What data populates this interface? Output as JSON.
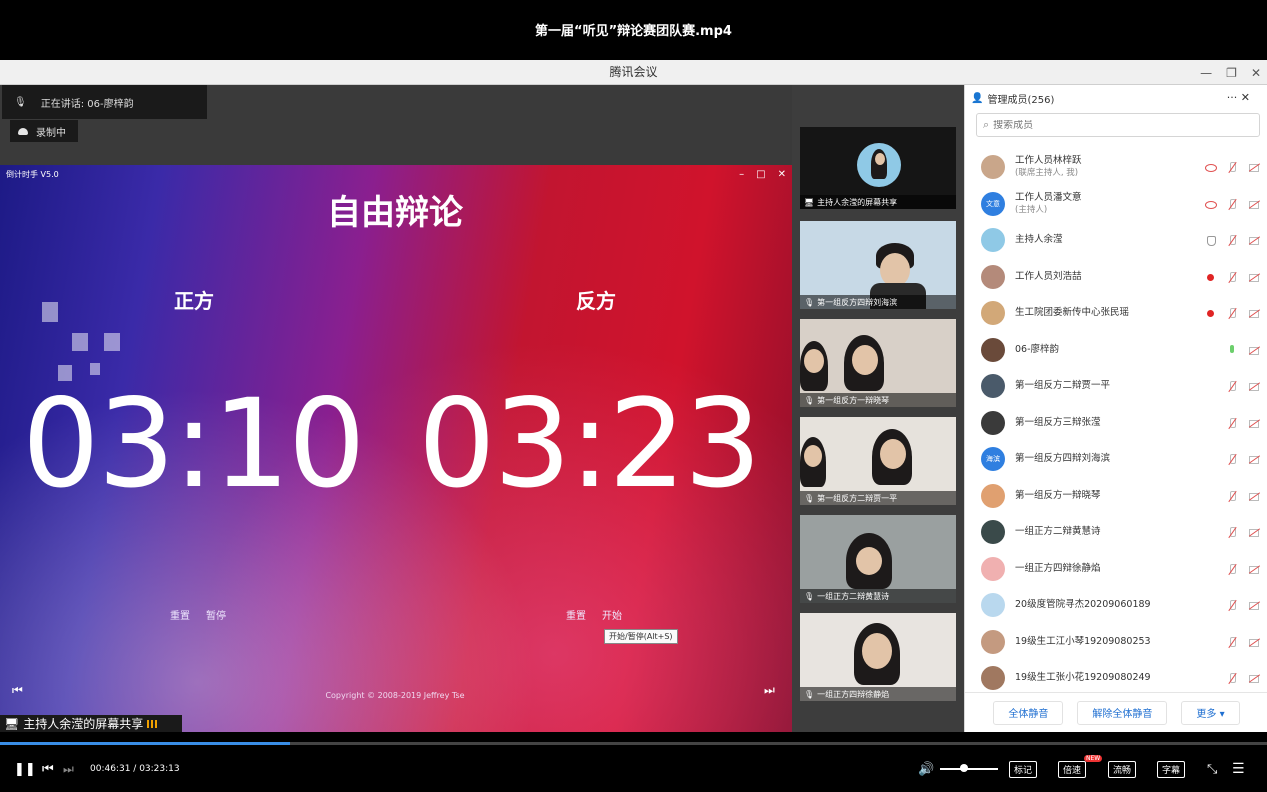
{
  "player": {
    "title": "第一届“听见”辩论赛团队赛.mp4",
    "current_time": "00:46:31",
    "separator": " / ",
    "total_time": "03:23:13",
    "progress": 0.229,
    "volume": 0.42,
    "buttons": {
      "mark": "标记",
      "speed": "倍速",
      "speed_badge": "NEW",
      "quality": "流畅",
      "subtitle": "字幕"
    },
    "accent": "#3a8ee6"
  },
  "meeting": {
    "title": "腾讯会议",
    "speaking": "正在讲话: 06-廖梓韵",
    "recording": "录制中",
    "share_label": "主持人余滢的屏幕共享"
  },
  "timer": {
    "app_name": "倒计时手 V5.0",
    "title": "自由辩论",
    "left_side": "正方",
    "right_side": "反方",
    "left_time": "03:10",
    "right_time": "03:23",
    "left_reset": "重置",
    "left_pause": "暂停",
    "right_reset": "重置",
    "right_start": "开始",
    "tooltip": "开始/暂停(Alt+S)",
    "copyright": "Copyright © 2008-2019 Jeffrey Tse"
  },
  "videos": [
    {
      "label": "主持人余滢的屏幕共享"
    },
    {
      "label": "第一组反方四辩刘海滨"
    },
    {
      "label": "第一组反方一辩晓琴"
    },
    {
      "label": "第一组反方二辩贾一平"
    },
    {
      "label": "一组正方二辩黄慧诗"
    },
    {
      "label": "一组正方四辩徐静焰"
    }
  ],
  "members": {
    "header": "管理成员(256)",
    "search_placeholder": "搜索成员",
    "list": [
      {
        "name": "工作人员林梓跃",
        "sub": "(联席主持人, 我)",
        "avatar_color": "#c9a68a",
        "avatar_text": "",
        "icons": [
          "eye",
          "mic-off",
          "cam-off"
        ]
      },
      {
        "name": "工作人员潘文意",
        "sub": "(主持人)",
        "avatar_color": "#2f7fe0",
        "avatar_text": "文意",
        "icons": [
          "eye",
          "mic-off",
          "cam-off"
        ]
      },
      {
        "name": "主持人余滢",
        "sub": "",
        "avatar_color": "#8fc9e6",
        "avatar_text": "",
        "icons": [
          "shield",
          "mic-off",
          "cam-off"
        ]
      },
      {
        "name": "工作人员刘浩喆",
        "sub": "",
        "avatar_color": "#b48a7a",
        "avatar_text": "",
        "icons": [
          "rec",
          "mic-off",
          "cam-off"
        ]
      },
      {
        "name": "生工院团委新传中心张民瑶",
        "sub": "",
        "avatar_color": "#d2a878",
        "avatar_text": "",
        "icons": [
          "rec",
          "mic-off",
          "cam-off"
        ]
      },
      {
        "name": "06-廖梓韵",
        "sub": "",
        "avatar_color": "#6a4a3a",
        "avatar_text": "",
        "icons": [
          "mic-on",
          "cam-off"
        ]
      },
      {
        "name": "第一组反方二辩贾一平",
        "sub": "",
        "avatar_color": "#4a5a6a",
        "avatar_text": "",
        "icons": [
          "mic-off",
          "cam-off"
        ]
      },
      {
        "name": "第一组反方三辩张滢",
        "sub": "",
        "avatar_color": "#3a3a3a",
        "avatar_text": "",
        "icons": [
          "mic-off",
          "cam-off"
        ]
      },
      {
        "name": "第一组反方四辩刘海滨",
        "sub": "",
        "avatar_color": "#2f7fe0",
        "avatar_text": "海滨",
        "icons": [
          "mic-off",
          "cam-off"
        ]
      },
      {
        "name": "第一组反方一辩晓琴",
        "sub": "",
        "avatar_color": "#e0a070",
        "avatar_text": "",
        "icons": [
          "mic-off",
          "cam-off"
        ]
      },
      {
        "name": "一组正方二辩黄慧诗",
        "sub": "",
        "avatar_color": "#3a4a4a",
        "avatar_text": "",
        "icons": [
          "mic-off",
          "cam-off"
        ]
      },
      {
        "name": "一组正方四辩徐静焰",
        "sub": "",
        "avatar_color": "#f0b0b0",
        "avatar_text": "",
        "icons": [
          "mic-off",
          "cam-off"
        ]
      },
      {
        "name": "20级度管院寻杰20209060189",
        "sub": "",
        "avatar_color": "#b9d8ee",
        "avatar_text": "",
        "icons": [
          "mic-off",
          "cam-off"
        ]
      },
      {
        "name": "19级生工江小琴19209080253",
        "sub": "",
        "avatar_color": "#c49a80",
        "avatar_text": "",
        "icons": [
          "mic-off",
          "cam-off"
        ]
      },
      {
        "name": "19级生工张小花19209080249",
        "sub": "",
        "avatar_color": "#a07860",
        "avatar_text": "",
        "icons": [
          "mic-off",
          "cam-off"
        ]
      }
    ],
    "footer": {
      "mute_all": "全体静音",
      "unmute_all": "解除全体静音",
      "more": "更多 ▾"
    }
  }
}
